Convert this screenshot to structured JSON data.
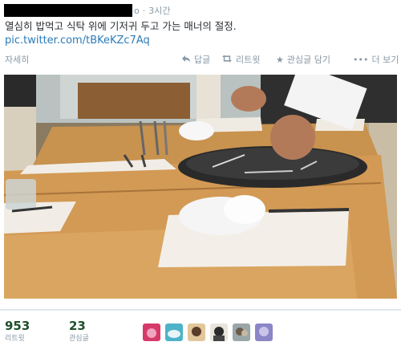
{
  "tweet": {
    "handle_tail": "o",
    "time": "3시간",
    "text": "열심히 밥먹고 식탁 위에 기저귀 두고 가는 매너의 절정.",
    "link": "pic.twitter.com/tBKeKZc7Aq"
  },
  "actions": {
    "detail": "자세히",
    "reply": "답글",
    "retweet": "리트윗",
    "favorite": "관심글 담기",
    "more": "더 보기"
  },
  "stats": {
    "retweets": {
      "value": "953",
      "label": "리트윗"
    },
    "favorites": {
      "value": "23",
      "label": "관심글"
    }
  },
  "icons": {
    "reply": "reply-icon",
    "retweet": "retweet-icon",
    "favorite": "star-icon",
    "more": "more-dots-icon"
  },
  "colors": {
    "link": "#2b7bb9",
    "muted": "#8899a6",
    "stat_number": "#1f4f2a"
  }
}
